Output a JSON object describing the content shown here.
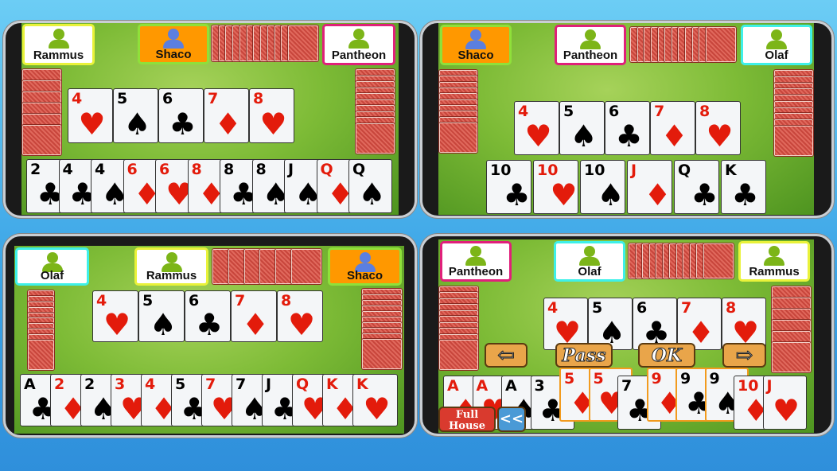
{
  "colors": {
    "background": "#3aa3e6",
    "table_felt": "#7dbb36",
    "active_player": "#ff9800",
    "card_red": "#e31b0b",
    "card_black": "#000000",
    "selected_card_border": "#f29b1e",
    "avatar_active": "#5b7fe0",
    "avatar_idle": "#7cb518"
  },
  "panels": [
    {
      "players": [
        {
          "name": "Rammus",
          "border": "#e9f23a",
          "active": false
        },
        {
          "name": "Shaco",
          "border": "#8fe03a",
          "active": true
        },
        {
          "name": "Pantheon",
          "border": "#e0207a",
          "active": false
        }
      ],
      "table": [
        {
          "rank": "4",
          "suit": "hearts"
        },
        {
          "rank": "5",
          "suit": "spades"
        },
        {
          "rank": "6",
          "suit": "clubs"
        },
        {
          "rank": "7",
          "suit": "diamonds"
        },
        {
          "rank": "8",
          "suit": "hearts"
        }
      ],
      "hand": [
        {
          "rank": "2",
          "suit": "clubs"
        },
        {
          "rank": "4",
          "suit": "clubs"
        },
        {
          "rank": "4",
          "suit": "spades"
        },
        {
          "rank": "6",
          "suit": "diamonds"
        },
        {
          "rank": "6",
          "suit": "hearts"
        },
        {
          "rank": "8",
          "suit": "diamonds"
        },
        {
          "rank": "8",
          "suit": "clubs"
        },
        {
          "rank": "8",
          "suit": "spades"
        },
        {
          "rank": "J",
          "suit": "spades"
        },
        {
          "rank": "Q",
          "suit": "diamonds"
        },
        {
          "rank": "Q",
          "suit": "spades"
        }
      ]
    },
    {
      "players": [
        {
          "name": "Shaco",
          "border": "#8fe03a",
          "active": true
        },
        {
          "name": "Pantheon",
          "border": "#e0207a",
          "active": false
        },
        {
          "name": "Olaf",
          "border": "#3ef0e8",
          "active": false
        }
      ],
      "table": [
        {
          "rank": "4",
          "suit": "hearts"
        },
        {
          "rank": "5",
          "suit": "spades"
        },
        {
          "rank": "6",
          "suit": "clubs"
        },
        {
          "rank": "7",
          "suit": "diamonds"
        },
        {
          "rank": "8",
          "suit": "hearts"
        }
      ],
      "hand": [
        {
          "rank": "10",
          "suit": "clubs"
        },
        {
          "rank": "10",
          "suit": "hearts"
        },
        {
          "rank": "10",
          "suit": "spades"
        },
        {
          "rank": "J",
          "suit": "diamonds"
        },
        {
          "rank": "Q",
          "suit": "clubs"
        },
        {
          "rank": "K",
          "suit": "clubs"
        }
      ]
    },
    {
      "players": [
        {
          "name": "Olaf",
          "border": "#3ef0e8",
          "active": false
        },
        {
          "name": "Rammus",
          "border": "#e9f23a",
          "active": false
        },
        {
          "name": "Shaco",
          "border": "#8fe03a",
          "active": true
        }
      ],
      "table": [
        {
          "rank": "4",
          "suit": "hearts"
        },
        {
          "rank": "5",
          "suit": "spades"
        },
        {
          "rank": "6",
          "suit": "clubs"
        },
        {
          "rank": "7",
          "suit": "diamonds"
        },
        {
          "rank": "8",
          "suit": "hearts"
        }
      ],
      "hand": [
        {
          "rank": "A",
          "suit": "clubs"
        },
        {
          "rank": "2",
          "suit": "diamonds"
        },
        {
          "rank": "2",
          "suit": "spades"
        },
        {
          "rank": "3",
          "suit": "hearts"
        },
        {
          "rank": "4",
          "suit": "diamonds"
        },
        {
          "rank": "5",
          "suit": "clubs"
        },
        {
          "rank": "7",
          "suit": "hearts"
        },
        {
          "rank": "7",
          "suit": "spades"
        },
        {
          "rank": "J",
          "suit": "clubs"
        },
        {
          "rank": "Q",
          "suit": "hearts"
        },
        {
          "rank": "K",
          "suit": "diamonds"
        },
        {
          "rank": "K",
          "suit": "hearts"
        }
      ]
    },
    {
      "players": [
        {
          "name": "Pantheon",
          "border": "#e0207a",
          "active": false
        },
        {
          "name": "Olaf",
          "border": "#3ef0e8",
          "active": false
        },
        {
          "name": "Rammus",
          "border": "#e9f23a",
          "active": false
        }
      ],
      "table": [
        {
          "rank": "4",
          "suit": "hearts"
        },
        {
          "rank": "5",
          "suit": "spades"
        },
        {
          "rank": "6",
          "suit": "clubs"
        },
        {
          "rank": "7",
          "suit": "diamonds"
        },
        {
          "rank": "8",
          "suit": "hearts"
        }
      ],
      "hand": [
        {
          "rank": "A",
          "suit": "diamonds"
        },
        {
          "rank": "A",
          "suit": "hearts"
        },
        {
          "rank": "A",
          "suit": "spades"
        },
        {
          "rank": "3",
          "suit": "clubs"
        },
        {
          "rank": "5",
          "suit": "diamonds",
          "selected": true
        },
        {
          "rank": "5",
          "suit": "hearts",
          "selected": true
        },
        {
          "rank": "7",
          "suit": "clubs"
        },
        {
          "rank": "9",
          "suit": "diamonds",
          "selected": true
        },
        {
          "rank": "9",
          "suit": "clubs",
          "selected": true
        },
        {
          "rank": "9",
          "suit": "spades",
          "selected": true
        },
        {
          "rank": "10",
          "suit": "diamonds"
        },
        {
          "rank": "J",
          "suit": "hearts"
        }
      ],
      "controls": {
        "prev_icon": "arrow-left-icon",
        "prev": "⇦",
        "pass": "Pass",
        "ok": "OK",
        "next_icon": "arrow-right-icon",
        "next": "⇨",
        "full_house": "Full House",
        "rewind": "<<"
      }
    }
  ]
}
